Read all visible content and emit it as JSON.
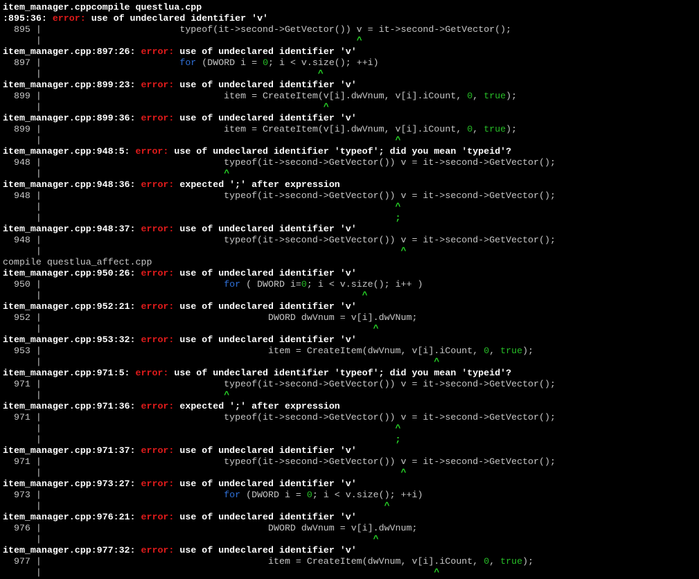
{
  "terminal": {
    "lines": [
      [
        {
          "t": "item_manager.cppcompile questlua.cpp",
          "c": "bold"
        }
      ],
      [
        {
          "t": ":895:36: ",
          "c": "bold"
        },
        {
          "t": "error:",
          "c": "err"
        },
        {
          "t": " use of undeclared identifier 'v'",
          "c": "bold"
        }
      ],
      [
        {
          "t": "  895 |                         typeof(it->second->GetVector()) v = it->second->GetVector();"
        }
      ],
      [
        {
          "t": "      |                                                         "
        },
        {
          "t": "^",
          "c": "caret"
        }
      ],
      [
        {
          "t": "item_manager.cpp:897:26: ",
          "c": "bold"
        },
        {
          "t": "error:",
          "c": "err"
        },
        {
          "t": " use of undeclared identifier 'v'",
          "c": "bold"
        }
      ],
      [
        {
          "t": "  897 |                         "
        },
        {
          "t": "for",
          "c": "kw"
        },
        {
          "t": " (DWORD i = "
        },
        {
          "t": "0",
          "c": "num"
        },
        {
          "t": "; i < v.size(); ++i)"
        }
      ],
      [
        {
          "t": "      |                                                  "
        },
        {
          "t": "^",
          "c": "caret"
        }
      ],
      [
        {
          "t": "item_manager.cpp:899:23: ",
          "c": "bold"
        },
        {
          "t": "error:",
          "c": "err"
        },
        {
          "t": " use of undeclared identifier 'v'",
          "c": "bold"
        }
      ],
      [
        {
          "t": "  899 |                                 item = CreateItem(v[i].dwVnum, v[i].iCount, "
        },
        {
          "t": "0",
          "c": "num"
        },
        {
          "t": ", "
        },
        {
          "t": "true",
          "c": "num"
        },
        {
          "t": ");"
        }
      ],
      [
        {
          "t": "      |                                                   "
        },
        {
          "t": "^",
          "c": "caret"
        }
      ],
      [
        {
          "t": "item_manager.cpp:899:36: ",
          "c": "bold"
        },
        {
          "t": "error:",
          "c": "err"
        },
        {
          "t": " use of undeclared identifier 'v'",
          "c": "bold"
        }
      ],
      [
        {
          "t": "  899 |                                 item = CreateItem(v[i].dwVnum, v[i].iCount, "
        },
        {
          "t": "0",
          "c": "num"
        },
        {
          "t": ", "
        },
        {
          "t": "true",
          "c": "num"
        },
        {
          "t": ");"
        }
      ],
      [
        {
          "t": "      |                                                                "
        },
        {
          "t": "^",
          "c": "caret"
        }
      ],
      [
        {
          "t": "item_manager.cpp:948:5: ",
          "c": "bold"
        },
        {
          "t": "error:",
          "c": "err"
        },
        {
          "t": " use of undeclared identifier 'typeof'; did you mean 'typeid'?",
          "c": "bold"
        }
      ],
      [
        {
          "t": "  948 |                                 typeof(it->second->GetVector()) v = it->second->GetVector();"
        }
      ],
      [
        {
          "t": "      |                                 "
        },
        {
          "t": "^",
          "c": "caret"
        }
      ],
      [
        {
          "t": "item_manager.cpp:948:36: ",
          "c": "bold"
        },
        {
          "t": "error:",
          "c": "err"
        },
        {
          "t": " expected ';' after expression",
          "c": "bold"
        }
      ],
      [
        {
          "t": "  948 |                                 typeof(it->second->GetVector()) v = it->second->GetVector();"
        }
      ],
      [
        {
          "t": "      |                                                                "
        },
        {
          "t": "^",
          "c": "caret"
        }
      ],
      [
        {
          "t": "      |                                                                "
        },
        {
          "t": ";",
          "c": "caret"
        }
      ],
      [
        {
          "t": "item_manager.cpp:948:37: ",
          "c": "bold"
        },
        {
          "t": "error:",
          "c": "err"
        },
        {
          "t": " use of undeclared identifier 'v'",
          "c": "bold"
        }
      ],
      [
        {
          "t": "  948 |                                 typeof(it->second->GetVector()) v = it->second->GetVector();"
        }
      ],
      [
        {
          "t": "      |                                                                 "
        },
        {
          "t": "^",
          "c": "caret"
        }
      ],
      [
        {
          "t": "compile questlua_affect.cpp"
        }
      ],
      [
        {
          "t": "item_manager.cpp:950:26: ",
          "c": "bold"
        },
        {
          "t": "error:",
          "c": "err"
        },
        {
          "t": " use of undeclared identifier 'v'",
          "c": "bold"
        }
      ],
      [
        {
          "t": "  950 |                                 "
        },
        {
          "t": "for",
          "c": "kw"
        },
        {
          "t": " ( DWORD i="
        },
        {
          "t": "0",
          "c": "num"
        },
        {
          "t": "; i < v.size(); i++ )"
        }
      ],
      [
        {
          "t": "      |                                                          "
        },
        {
          "t": "^",
          "c": "caret"
        }
      ],
      [
        {
          "t": "item_manager.cpp:952:21: ",
          "c": "bold"
        },
        {
          "t": "error:",
          "c": "err"
        },
        {
          "t": " use of undeclared identifier 'v'",
          "c": "bold"
        }
      ],
      [
        {
          "t": "  952 |                                         DWORD dwVnum = v[i].dwVNum;"
        }
      ],
      [
        {
          "t": "      |                                                            "
        },
        {
          "t": "^",
          "c": "caret"
        }
      ],
      [
        {
          "t": "item_manager.cpp:953:32: ",
          "c": "bold"
        },
        {
          "t": "error:",
          "c": "err"
        },
        {
          "t": " use of undeclared identifier 'v'",
          "c": "bold"
        }
      ],
      [
        {
          "t": "  953 |                                         item = CreateItem(dwVnum, v[i].iCount, "
        },
        {
          "t": "0",
          "c": "num"
        },
        {
          "t": ", "
        },
        {
          "t": "true",
          "c": "num"
        },
        {
          "t": ");"
        }
      ],
      [
        {
          "t": "      |                                                                       "
        },
        {
          "t": "^",
          "c": "caret"
        }
      ],
      [
        {
          "t": "item_manager.cpp:971:5: ",
          "c": "bold"
        },
        {
          "t": "error:",
          "c": "err"
        },
        {
          "t": " use of undeclared identifier 'typeof'; did you mean 'typeid'?",
          "c": "bold"
        }
      ],
      [
        {
          "t": "  971 |                                 typeof(it->second->GetVector()) v = it->second->GetVector();"
        }
      ],
      [
        {
          "t": "      |                                 "
        },
        {
          "t": "^",
          "c": "caret"
        }
      ],
      [
        {
          "t": "item_manager.cpp:971:36: ",
          "c": "bold"
        },
        {
          "t": "error:",
          "c": "err"
        },
        {
          "t": " expected ';' after expression",
          "c": "bold"
        }
      ],
      [
        {
          "t": "  971 |                                 typeof(it->second->GetVector()) v = it->second->GetVector();"
        }
      ],
      [
        {
          "t": "      |                                                                "
        },
        {
          "t": "^",
          "c": "caret"
        }
      ],
      [
        {
          "t": "      |                                                                "
        },
        {
          "t": ";",
          "c": "caret"
        }
      ],
      [
        {
          "t": "item_manager.cpp:971:37: ",
          "c": "bold"
        },
        {
          "t": "error:",
          "c": "err"
        },
        {
          "t": " use of undeclared identifier 'v'",
          "c": "bold"
        }
      ],
      [
        {
          "t": "  971 |                                 typeof(it->second->GetVector()) v = it->second->GetVector();"
        }
      ],
      [
        {
          "t": "      |                                                                 "
        },
        {
          "t": "^",
          "c": "caret"
        }
      ],
      [
        {
          "t": "item_manager.cpp:973:27: ",
          "c": "bold"
        },
        {
          "t": "error:",
          "c": "err"
        },
        {
          "t": " use of undeclared identifier 'v'",
          "c": "bold"
        }
      ],
      [
        {
          "t": "  973 |                                 "
        },
        {
          "t": "for",
          "c": "kw"
        },
        {
          "t": " (DWORD i = "
        },
        {
          "t": "0",
          "c": "num"
        },
        {
          "t": "; i < v.size(); ++i)"
        }
      ],
      [
        {
          "t": "      |                                                              "
        },
        {
          "t": "^",
          "c": "caret"
        }
      ],
      [
        {
          "t": "item_manager.cpp:976:21: ",
          "c": "bold"
        },
        {
          "t": "error:",
          "c": "err"
        },
        {
          "t": " use of undeclared identifier 'v'",
          "c": "bold"
        }
      ],
      [
        {
          "t": "  976 |                                         DWORD dwVnum = v[i].dwVnum;"
        }
      ],
      [
        {
          "t": "      |                                                            "
        },
        {
          "t": "^",
          "c": "caret"
        }
      ],
      [
        {
          "t": "item_manager.cpp:977:32: ",
          "c": "bold"
        },
        {
          "t": "error:",
          "c": "err"
        },
        {
          "t": " use of undeclared identifier 'v'",
          "c": "bold"
        }
      ],
      [
        {
          "t": "  977 |                                         item = CreateItem(dwVnum, v[i].iCount, "
        },
        {
          "t": "0",
          "c": "num"
        },
        {
          "t": ", "
        },
        {
          "t": "true",
          "c": "num"
        },
        {
          "t": ");"
        }
      ],
      [
        {
          "t": "      |                                                                       "
        },
        {
          "t": "^",
          "c": "caret"
        }
      ]
    ]
  },
  "colors": {
    "background": "#000000",
    "text": "#c6c6c6",
    "error": "#e01b1b",
    "keyword": "#2f6fd6",
    "literal": "#27bd27",
    "caret": "#27d627"
  }
}
